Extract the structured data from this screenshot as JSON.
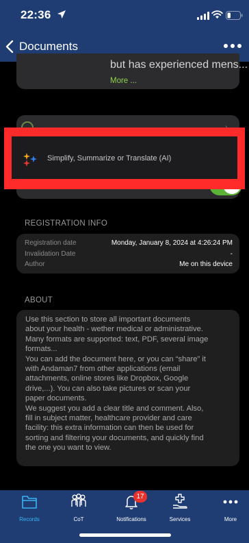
{
  "status_bar": {
    "time": "22:36"
  },
  "nav": {
    "back_label": "Documents",
    "more_icon": "ellipsis-icon"
  },
  "top_card": {
    "text": "but has experienced mens...",
    "more_link": "More ..."
  },
  "ai_feature": {
    "label": "Simplify, Summarize or Translate (AI)",
    "toggle_on": true
  },
  "registration": {
    "title": "REGISTRATION INFO",
    "rows": [
      {
        "key": "Registration date",
        "value": "Monday, January 8, 2024 at 4:26:24 PM"
      },
      {
        "key": "Invalidation Date",
        "value": "-"
      },
      {
        "key": "Author",
        "value": "Me on this device"
      }
    ]
  },
  "about": {
    "title": "ABOUT",
    "lines": [
      "Use this section to store all important documents",
      "about your health - wether medical or administrative.",
      "Many formats are supported: text, PDF, several image",
      "formats...",
      "You can add the document here, or you can “share” it",
      "with Andaman7 from other applications (email",
      "attachments, online stores like Dropbox, Google",
      "drive,...). You can also take pictures or scan your",
      "paper documents.",
      "We suggest you add a clear title and comment. Also,",
      "fill in subject matter, healthcare provider and care",
      "facility: this extra information can then be used for",
      "sorting and filtering your documents, and quickly find",
      "the one you want to view."
    ]
  },
  "tabbar": {
    "tabs": [
      {
        "label": "Records",
        "icon": "folder-icon",
        "active": true
      },
      {
        "label": "CoT",
        "icon": "people-icon"
      },
      {
        "label": "Notifications",
        "icon": "bell-icon",
        "badge": "17"
      },
      {
        "label": "Services",
        "icon": "medical-services-icon"
      },
      {
        "label": "More",
        "icon": "ellipsis-icon"
      }
    ]
  },
  "colors": {
    "header_bg": "#1f3d73",
    "accent_green": "#8fd14f",
    "toggle_green": "#5cb338",
    "highlight_red": "#ff2a2a",
    "active_tab": "#3ab4f2",
    "badge_red": "#e8322d"
  }
}
